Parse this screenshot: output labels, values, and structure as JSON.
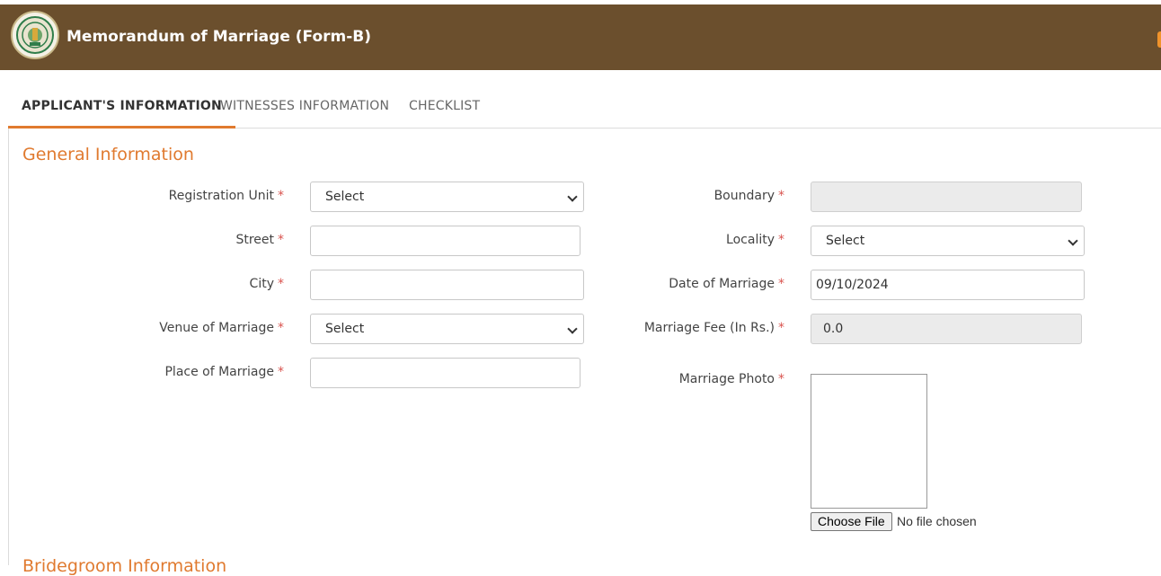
{
  "header": {
    "title": "Memorandum of Marriage (Form-B)",
    "logo_icon": "state-emblem-icon",
    "background_color": "#6b4f2d"
  },
  "tabs": [
    {
      "label": "APPLICANT'S INFORMATION",
      "active": true
    },
    {
      "label": "WITNESSES INFORMATION",
      "active": false
    },
    {
      "label": "CHECKLIST",
      "active": false
    }
  ],
  "accent_color": "#e07a2f",
  "general": {
    "title": "General Information",
    "required_marker": "*",
    "registration_unit": {
      "label": "Registration Unit",
      "value": "Select"
    },
    "street": {
      "label": "Street",
      "value": ""
    },
    "city": {
      "label": "City",
      "value": ""
    },
    "venue": {
      "label": "Venue of Marriage",
      "value": "Select"
    },
    "place": {
      "label": "Place of Marriage",
      "value": ""
    },
    "boundary": {
      "label": "Boundary",
      "value": ""
    },
    "locality": {
      "label": "Locality",
      "value": "Select"
    },
    "date": {
      "label": "Date of Marriage",
      "value": "09/10/2024"
    },
    "fee": {
      "label": "Marriage Fee (In Rs.)",
      "value": "0.0"
    },
    "photo": {
      "label": "Marriage Photo",
      "button": "Choose File",
      "status": "No file chosen"
    }
  },
  "next_section": {
    "title": "Bridegroom Information"
  }
}
